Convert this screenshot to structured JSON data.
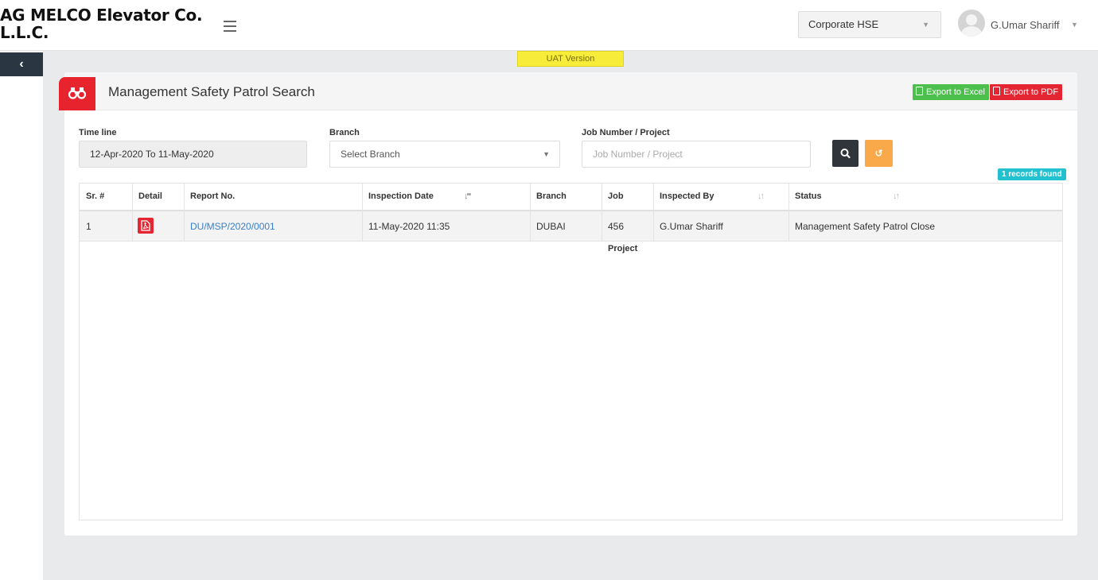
{
  "header": {
    "brand": "AG MELCO Elevator Co. L.L.C.",
    "role_selected": "Corporate HSE",
    "user_name": "G.Umar Shariff"
  },
  "banner": "UAT Version",
  "page": {
    "title": "Management Safety Patrol Search",
    "export_excel": "Export to Excel",
    "export_pdf": "Export to PDF"
  },
  "filters": {
    "timeline_label": "Time line",
    "timeline_value": "12-Apr-2020 To 11-May-2020",
    "branch_label": "Branch",
    "branch_value": "Select Branch",
    "job_label": "Job Number / Project",
    "job_placeholder": "Job Number / Project"
  },
  "records_found": "1 records found",
  "table": {
    "headers": {
      "sr": "Sr. #",
      "detail": "Detail",
      "report": "Report No.",
      "inspection_date": "Inspection Date",
      "branch": "Branch",
      "job": "Job Number / Project",
      "inspected_by": "Inspected By",
      "status": "Status"
    },
    "rows": [
      {
        "sr": "1",
        "report": "DU/MSP/2020/0001",
        "inspection_date": "11-May-2020 11:35",
        "branch": "DUBAI",
        "job": "456",
        "inspected_by": "G.Umar Shariff",
        "status": "Management Safety Patrol Close"
      }
    ]
  },
  "icons": {
    "menu": "hamburger-icon",
    "collapse": "chevron-left-icon",
    "title": "binoculars-icon",
    "search": "search-icon",
    "reset": "refresh-icon",
    "detail": "pdf-file-icon",
    "sort": "sort-icon"
  },
  "colors": {
    "accent_red": "#e7232e",
    "excel_green": "#4cbf4c",
    "search_dark": "#2f353b",
    "reset_orange": "#f9a949",
    "records_cyan": "#23c0cf",
    "uat_yellow": "#f7ec3a",
    "link_blue": "#3b7fc4"
  }
}
